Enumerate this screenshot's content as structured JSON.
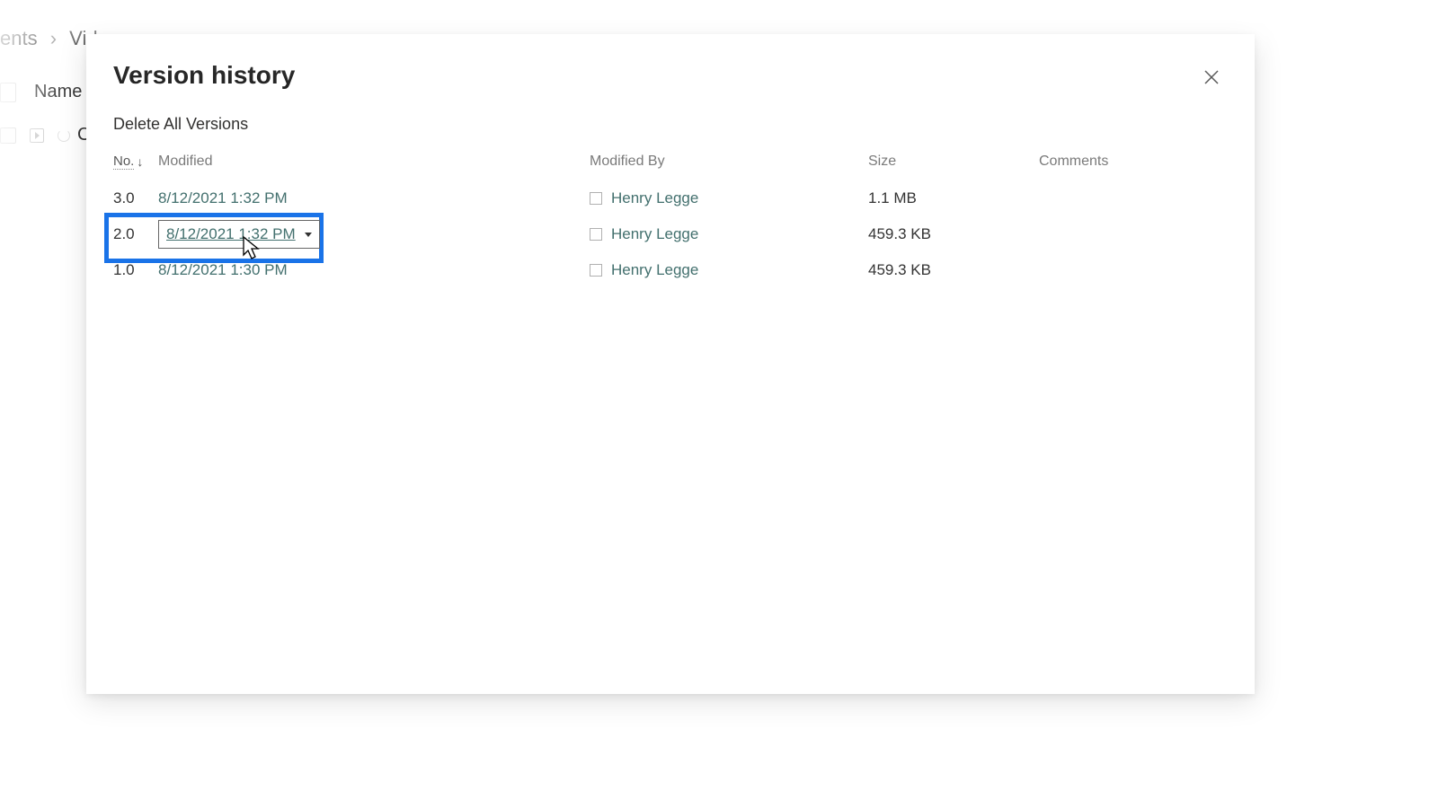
{
  "background": {
    "breadcrumb_parent": "ents",
    "breadcrumb_current": "Vid",
    "header_name": "Name",
    "item_name": "Car Vid"
  },
  "modal": {
    "title": "Version history",
    "delete_all": "Delete All Versions",
    "headers": {
      "no": "No.",
      "modified": "Modified",
      "modified_by": "Modified By",
      "size": "Size",
      "comments": "Comments"
    },
    "rows": [
      {
        "no": "3.0",
        "modified": "8/12/2021 1:32 PM",
        "by": "Henry Legge",
        "size": "1.1 MB",
        "highlighted": false
      },
      {
        "no": "2.0",
        "modified": "8/12/2021 1:32 PM",
        "by": "Henry Legge",
        "size": "459.3 KB",
        "highlighted": true
      },
      {
        "no": "1.0",
        "modified": "8/12/2021 1:30 PM",
        "by": "Henry Legge",
        "size": "459.3 KB",
        "highlighted": false
      }
    ]
  }
}
